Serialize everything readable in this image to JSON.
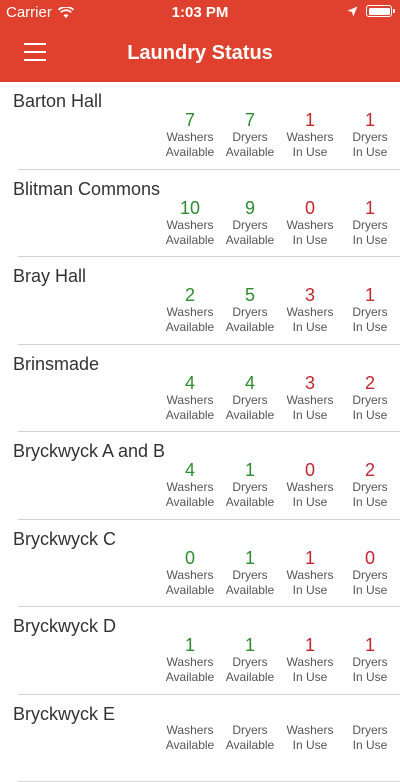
{
  "status_bar": {
    "carrier": "Carrier",
    "time": "1:03 PM"
  },
  "header": {
    "title": "Laundry Status",
    "menu_icon": "hamburger-menu-icon"
  },
  "labels": {
    "washers_available": "Washers\nAvailable",
    "dryers_available": "Dryers\nAvailable",
    "washers_in_use": "Washers\nIn Use",
    "dryers_in_use": "Dryers\nIn Use"
  },
  "colors": {
    "header": "#e0412e",
    "available": "#2e8b2e",
    "in_use": "#c2272d"
  },
  "halls": [
    {
      "name": "Barton Hall",
      "washers_available": "7",
      "dryers_available": "7",
      "washers_in_use": "1",
      "dryers_in_use": "1"
    },
    {
      "name": "Blitman Commons",
      "washers_available": "10",
      "dryers_available": "9",
      "washers_in_use": "0",
      "dryers_in_use": "1"
    },
    {
      "name": "Bray Hall",
      "washers_available": "2",
      "dryers_available": "5",
      "washers_in_use": "3",
      "dryers_in_use": "1"
    },
    {
      "name": "Brinsmade",
      "washers_available": "4",
      "dryers_available": "4",
      "washers_in_use": "3",
      "dryers_in_use": "2"
    },
    {
      "name": "Bryckwyck A and B",
      "washers_available": "4",
      "dryers_available": "1",
      "washers_in_use": "0",
      "dryers_in_use": "2"
    },
    {
      "name": "Bryckwyck C",
      "washers_available": "0",
      "dryers_available": "1",
      "washers_in_use": "1",
      "dryers_in_use": "0"
    },
    {
      "name": "Bryckwyck D",
      "washers_available": "1",
      "dryers_available": "1",
      "washers_in_use": "1",
      "dryers_in_use": "1"
    },
    {
      "name": "Bryckwyck E",
      "washers_available": "",
      "dryers_available": "",
      "washers_in_use": "",
      "dryers_in_use": ""
    }
  ]
}
